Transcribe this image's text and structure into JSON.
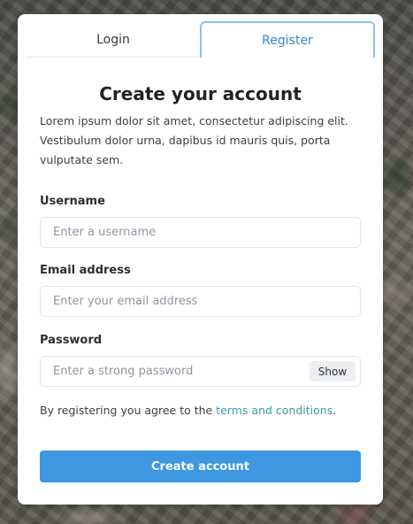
{
  "tabs": {
    "login": "Login",
    "register": "Register",
    "active": "register"
  },
  "form": {
    "title": "Create your account",
    "intro": "Lorem ipsum dolor sit amet, consectetur adipiscing elit. Vestibulum dolor urna, dapibus id mauris quis, porta vulputate sem.",
    "username": {
      "label": "Username",
      "placeholder": "Enter a username",
      "value": ""
    },
    "email": {
      "label": "Email address",
      "placeholder": "Enter your email address",
      "value": ""
    },
    "password": {
      "label": "Password",
      "placeholder": "Enter a strong password",
      "value": "",
      "toggle_label": "Show"
    },
    "terms_prefix": "By registering you agree to the",
    "terms_link": "terms and conditions",
    "terms_suffix": ".",
    "submit_label": "Create account"
  },
  "colors": {
    "accent": "#3d97e1",
    "tab_active_text": "#3a86c8",
    "tab_active_border": "#8fc0ea",
    "link": "#3a9ca4"
  }
}
